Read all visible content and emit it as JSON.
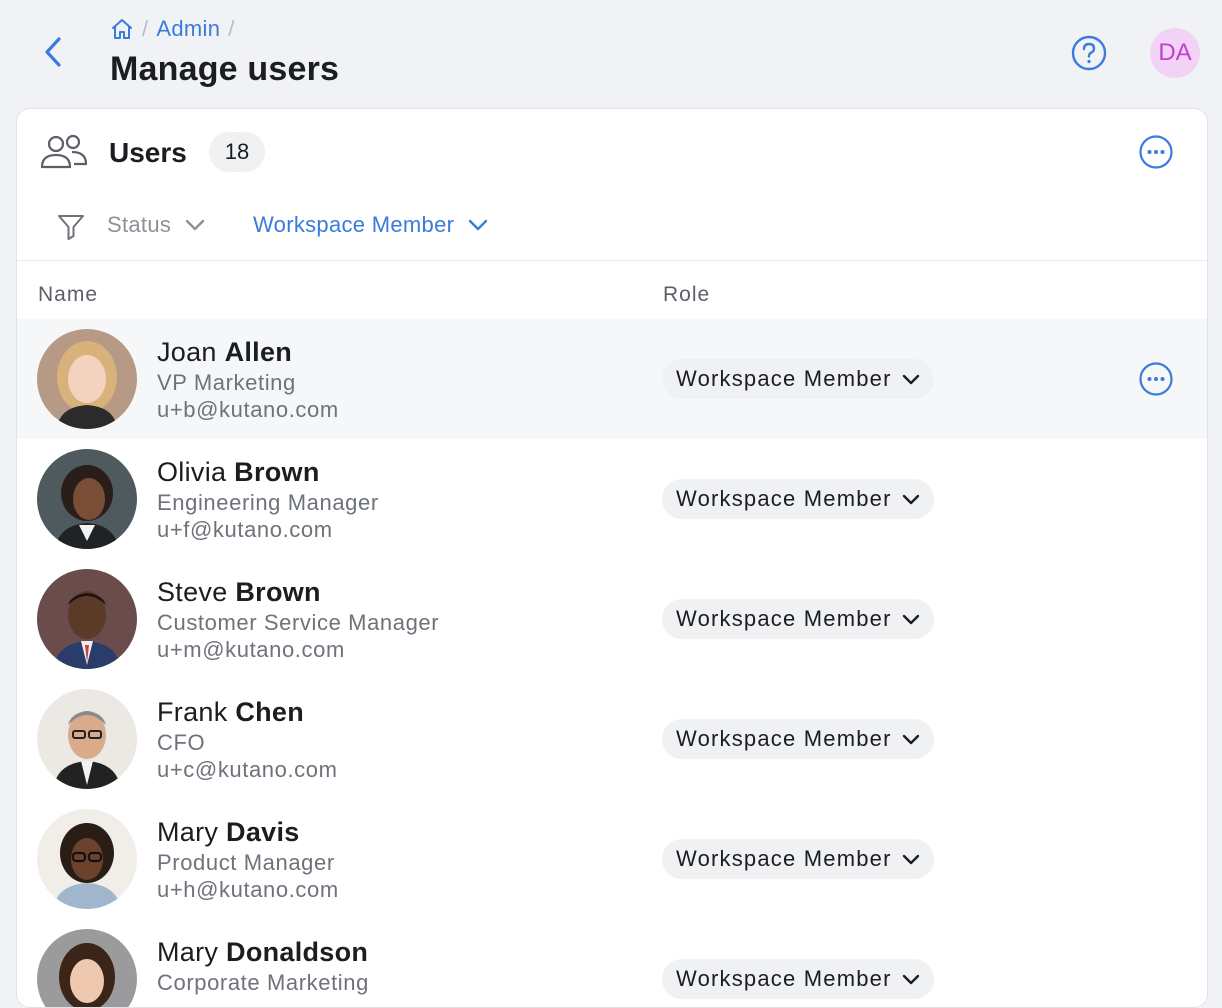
{
  "header": {
    "breadcrumb": {
      "home_icon": "home-icon",
      "admin": "Admin",
      "sep": "/"
    },
    "title": "Manage users",
    "avatar_initials": "DA"
  },
  "card": {
    "title": "Users",
    "count": "18",
    "filters": {
      "status": "Status",
      "member": "Workspace Member"
    },
    "columns": {
      "name": "Name",
      "role": "Role"
    }
  },
  "colors": {
    "accent": "#3a7bdc",
    "avatar_bg": "#f2d3f5",
    "avatar_fg": "#c23fd1"
  },
  "users": [
    {
      "first": "Joan",
      "last": "Allen",
      "title": "VP Marketing",
      "email": "u+b@kutano.com",
      "role": "Workspace Member"
    },
    {
      "first": "Olivia",
      "last": "Brown",
      "title": "Engineering Manager",
      "email": "u+f@kutano.com",
      "role": "Workspace Member"
    },
    {
      "first": "Steve",
      "last": "Brown",
      "title": "Customer Service Manager",
      "email": "u+m@kutano.com",
      "role": "Workspace Member"
    },
    {
      "first": "Frank",
      "last": "Chen",
      "title": "CFO",
      "email": "u+c@kutano.com",
      "role": "Workspace Member"
    },
    {
      "first": "Mary",
      "last": "Davis",
      "title": "Product Manager",
      "email": "u+h@kutano.com",
      "role": "Workspace Member"
    },
    {
      "first": "Mary",
      "last": "Donaldson",
      "title": "Corporate Marketing",
      "email": "",
      "role": "Workspace Member"
    }
  ]
}
